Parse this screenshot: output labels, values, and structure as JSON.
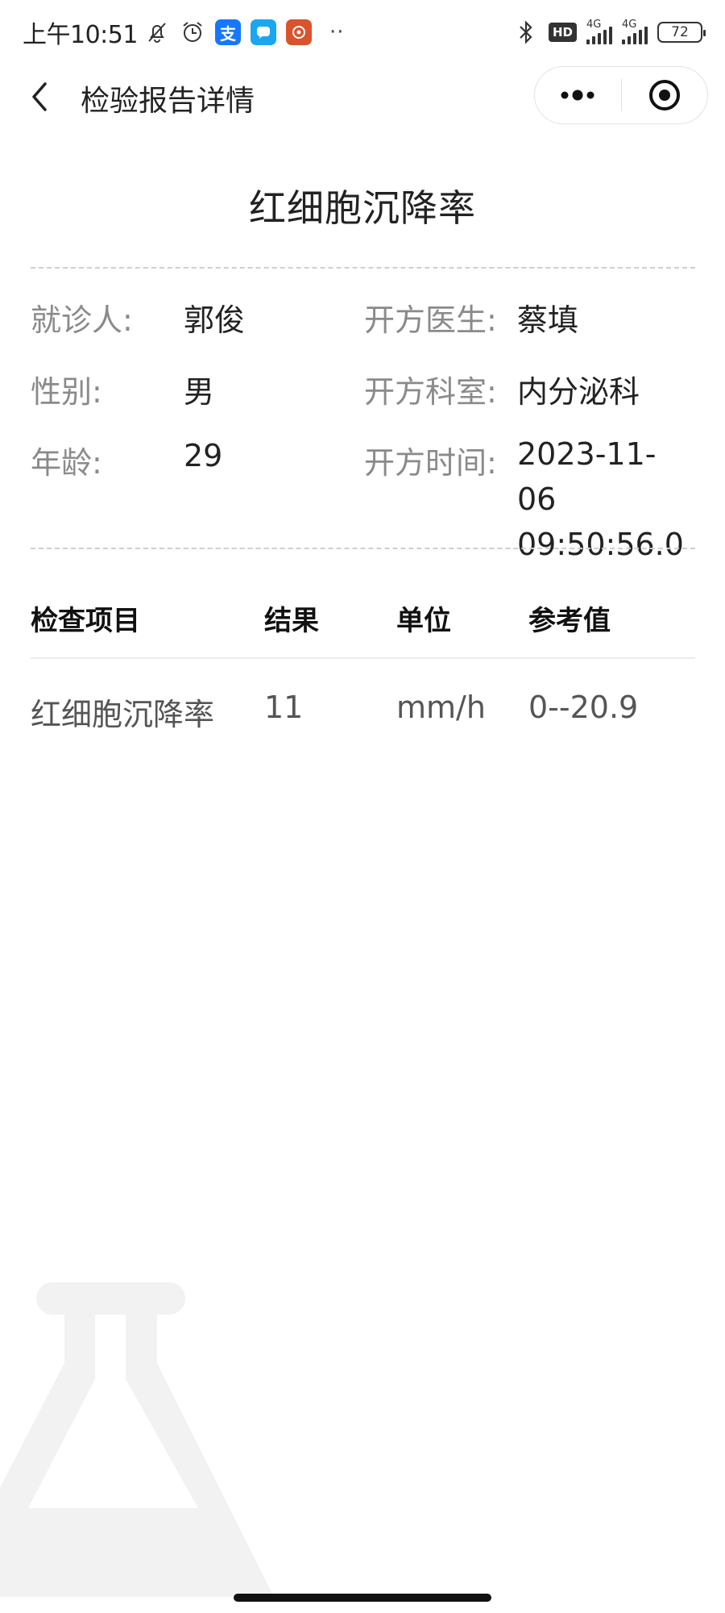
{
  "status_bar": {
    "time": "上午10:51",
    "network_1": "4G",
    "network_2": "4G",
    "hd_label": "HD",
    "battery": "72",
    "alipay_glyph": "支",
    "more_glyph": "··"
  },
  "nav": {
    "title": "检验报告详情",
    "back_icon": "chevron-left-icon",
    "more_icon": "more-dots-icon",
    "close_icon": "target-circle-icon"
  },
  "report": {
    "title": "红细胞沉降率"
  },
  "patient_info": {
    "patient_label": "就诊人:",
    "patient_value": "郭俊",
    "gender_label": "性别:",
    "gender_value": "男",
    "age_label": "年龄:",
    "age_value": "29",
    "doctor_label": "开方医生:",
    "doctor_value": "蔡填",
    "department_label": "开方科室:",
    "department_value": "内分泌科",
    "time_label": "开方时间:",
    "time_value": "2023-11-06 09:50:56.0"
  },
  "results_table": {
    "headers": [
      "检查项目",
      "结果",
      "单位",
      "参考值"
    ],
    "rows": [
      [
        "红细胞沉降率",
        "11",
        "mm/h",
        "0--20.9"
      ]
    ]
  },
  "colors": {
    "label_gray": "#8a8a8a",
    "text_dark": "#222222",
    "divider": "#cfcfcf",
    "watermark": "#f2f2f2"
  }
}
